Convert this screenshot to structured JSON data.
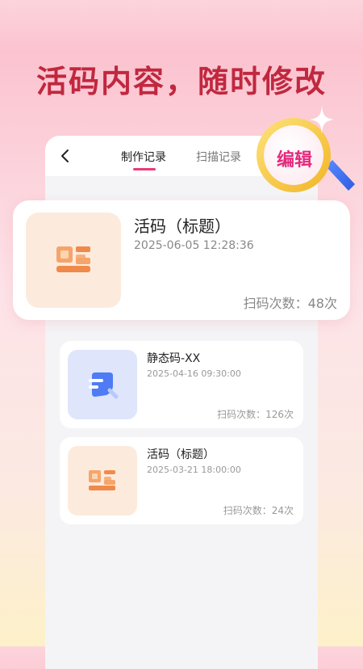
{
  "headline": "活码内容，随时修改",
  "header": {
    "tabs": [
      {
        "label": "制作记录",
        "active": true
      },
      {
        "label": "扫描记录",
        "active": false
      }
    ]
  },
  "badge": {
    "label": "编辑"
  },
  "featured": {
    "title": "活码（标题）",
    "date": "2025-06-05 12:28:36",
    "scan_count": "扫码次数：48次"
  },
  "items": [
    {
      "title": "静态码-XX",
      "date": "2025-04-16 09:30:00",
      "scan_count": "扫码次数：126次",
      "icon": "static-code-icon"
    },
    {
      "title": "活码（标题）",
      "date": "2025-03-21 18:00:00",
      "scan_count": "扫码次数：24次",
      "icon": "live-code-icon"
    }
  ],
  "colors": {
    "headline": "#c0283f",
    "accent": "#e8397a",
    "badge_text": "#e42a7d",
    "badge_ring": "#f6c744",
    "handle": "#3a6cf0"
  }
}
